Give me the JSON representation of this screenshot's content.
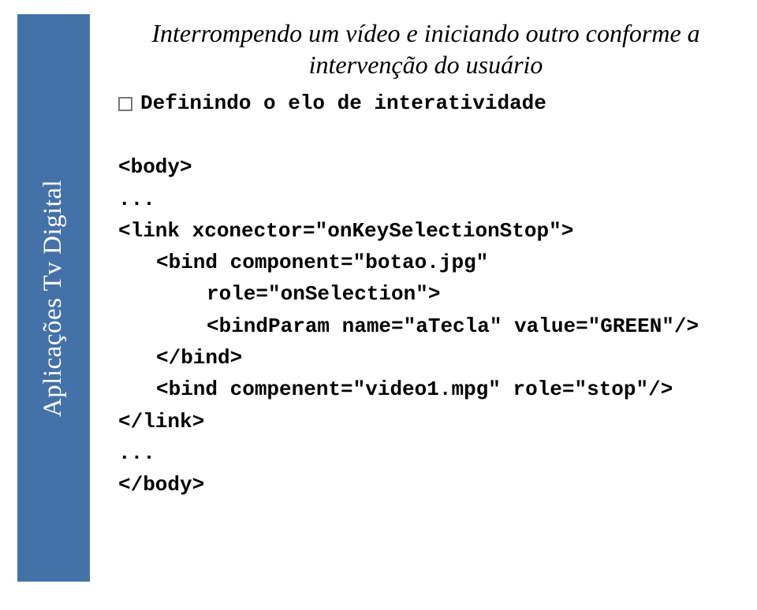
{
  "sidebar": {
    "label": "Aplicações Tv Digital"
  },
  "content": {
    "title_line1": "Interrompendo um vídeo e iniciando outro conforme a",
    "title_line2": "intervenção do usuário",
    "bullet_text": "Definindo o elo de interatividade",
    "code": {
      "l1": "<body>",
      "l2": "...",
      "l3": "<link xconector=\"onKeySelectionStop\">",
      "l4": "<bind component=\"botao.jpg\"",
      "l5": "role=\"onSelection\">",
      "l6": "<bindParam name=\"aTecla\" value=\"GREEN\"/>",
      "l7": "</bind>",
      "l8": "<bind compenent=\"video1.mpg\" role=\"stop\"/>",
      "l9": "</link>",
      "l10": "...",
      "l11": "</body>"
    }
  }
}
